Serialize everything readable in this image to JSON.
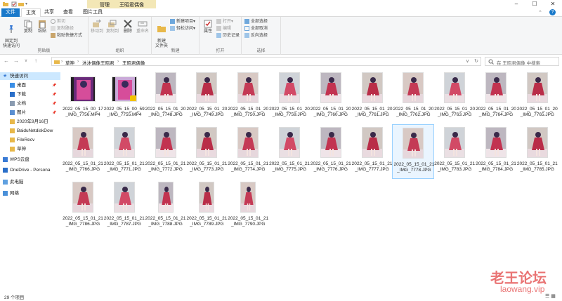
{
  "titlebar": {
    "manage": "管理",
    "name": "王昭君偶像"
  },
  "tabs": [
    {
      "label": "文件"
    },
    {
      "label": "主页"
    },
    {
      "label": "共享"
    },
    {
      "label": "查看"
    },
    {
      "label": "图片工具"
    }
  ],
  "ribbon": {
    "clipboard": {
      "label": "剪贴板",
      "pin": "固定到\n快速访问",
      "copy": "复制",
      "paste": "粘贴",
      "cut": "剪切",
      "copy_path": "复制路径",
      "paste_shortcut": "粘贴快捷方式"
    },
    "organize": {
      "label": "组织",
      "move_to": "移动到",
      "copy_to": "复制到",
      "delete": "删除",
      "rename": "重命名"
    },
    "new": {
      "label": "新建",
      "new_folder": "新建\n文件夹",
      "new_item": "新建项目",
      "easy_access": "轻松访问"
    },
    "open": {
      "label": "打开",
      "properties": "属性",
      "open": "打开",
      "edit": "编辑",
      "history": "历史记录"
    },
    "select": {
      "label": "选择",
      "select_all": "全部选择",
      "select_none": "全部取消",
      "invert": "反向选择"
    }
  },
  "address": {
    "crumbs": [
      "草神",
      "沐沐偶像王昭君",
      "王昭君偶像"
    ],
    "search_placeholder": "在 王昭君偶像 中搜索"
  },
  "nav": {
    "items": [
      {
        "label": "快速访问",
        "icon": "star-icon"
      },
      {
        "label": "桌面",
        "icon": "desktop-icon"
      },
      {
        "label": "下载",
        "icon": "download-icon"
      },
      {
        "label": "文档",
        "icon": "document-icon"
      },
      {
        "label": "图片",
        "icon": "picture-icon"
      },
      {
        "label": "2020年9月16日",
        "icon": "folder-icon"
      },
      {
        "label": "BaiduNetdiskDow",
        "icon": "folder-icon"
      },
      {
        "label": "FileRecv",
        "icon": "folder-icon"
      },
      {
        "label": "草神",
        "icon": "folder-icon"
      },
      {
        "label": "WPS云盘",
        "icon": "cloud-icon"
      },
      {
        "label": "OneDrive - Persona",
        "icon": "onedrive-icon"
      },
      {
        "label": "此电脑",
        "icon": "computer-icon"
      },
      {
        "label": "网络",
        "icon": "network-icon"
      }
    ]
  },
  "files": [
    {
      "name": "2022_05_15_00_17_IMG_7756.MP4",
      "type": "video"
    },
    {
      "name": "2022_05_15_00_59_IMG_7755.MP4",
      "type": "video"
    },
    {
      "name": "2022_05_15_01_20_IMG_7748.JPG",
      "type": "img"
    },
    {
      "name": "2022_05_15_01_20_IMG_7749.JPG",
      "type": "img"
    },
    {
      "name": "2022_05_15_01_20_IMG_7750.JPG",
      "type": "img"
    },
    {
      "name": "2022_05_15_01_20_IMG_7759.JPG",
      "type": "img"
    },
    {
      "name": "2022_05_15_01_20_IMG_7760.JPG",
      "type": "img"
    },
    {
      "name": "2022_05_15_01_20_IMG_7761.JPG",
      "type": "img"
    },
    {
      "name": "2022_05_15_01_20_IMG_7762.JPG",
      "type": "img"
    },
    {
      "name": "2022_05_15_01_20_IMG_7763.JPG",
      "type": "img"
    },
    {
      "name": "2022_05_15_01_20_IMG_7764.JPG",
      "type": "img"
    },
    {
      "name": "2022_05_15_01_20_IMG_7765.JPG",
      "type": "img"
    },
    {
      "name": "2022_05_15_01_21_IMG_7766.JPG",
      "type": "img"
    },
    {
      "name": "2022_05_15_01_21_IMG_7771.JPG",
      "type": "img"
    },
    {
      "name": "2022_05_15_01_21_IMG_7772.JPG",
      "type": "img"
    },
    {
      "name": "2022_05_15_01_21_IMG_7773.JPG",
      "type": "img"
    },
    {
      "name": "2022_05_15_01_21_IMG_7774.JPG",
      "type": "img"
    },
    {
      "name": "2022_05_15_01_21_IMG_7775.JPG",
      "type": "img"
    },
    {
      "name": "2022_05_15_01_21_IMG_7776.JPG",
      "type": "img"
    },
    {
      "name": "2022_05_15_01_21_IMG_7777.JPG",
      "type": "img"
    },
    {
      "name": "2022_05_15_01_21_IMG_7778.JPG",
      "type": "img"
    },
    {
      "name": "2022_05_15_01_21_IMG_7783.JPG",
      "type": "img"
    },
    {
      "name": "2022_05_15_01_21_IMG_7784.JPG",
      "type": "img"
    },
    {
      "name": "2022_05_15_01_21_IMG_7785.JPG",
      "type": "img"
    },
    {
      "name": "2022_05_15_01_21_IMG_7786.JPG",
      "type": "img"
    },
    {
      "name": "2022_05_15_01_21_IMG_7787.JPG",
      "type": "img"
    },
    {
      "name": "2022_05_15_01_21_IMG_7788.JPG",
      "type": "img"
    },
    {
      "name": "2022_05_15_01_21_IMG_7789.JPG",
      "type": "img"
    },
    {
      "name": "2022_05_15_01_21_IMG_7790.JPG",
      "type": "img"
    }
  ],
  "status": {
    "count": "29 个项目"
  },
  "watermark": {
    "line1": "老王论坛",
    "line2": "laowang.vip"
  },
  "colors": {
    "accent": "#1979ca",
    "selection": "#cce8ff",
    "context_tab": "#f3e7b6",
    "watermark": "#e03a3a"
  }
}
